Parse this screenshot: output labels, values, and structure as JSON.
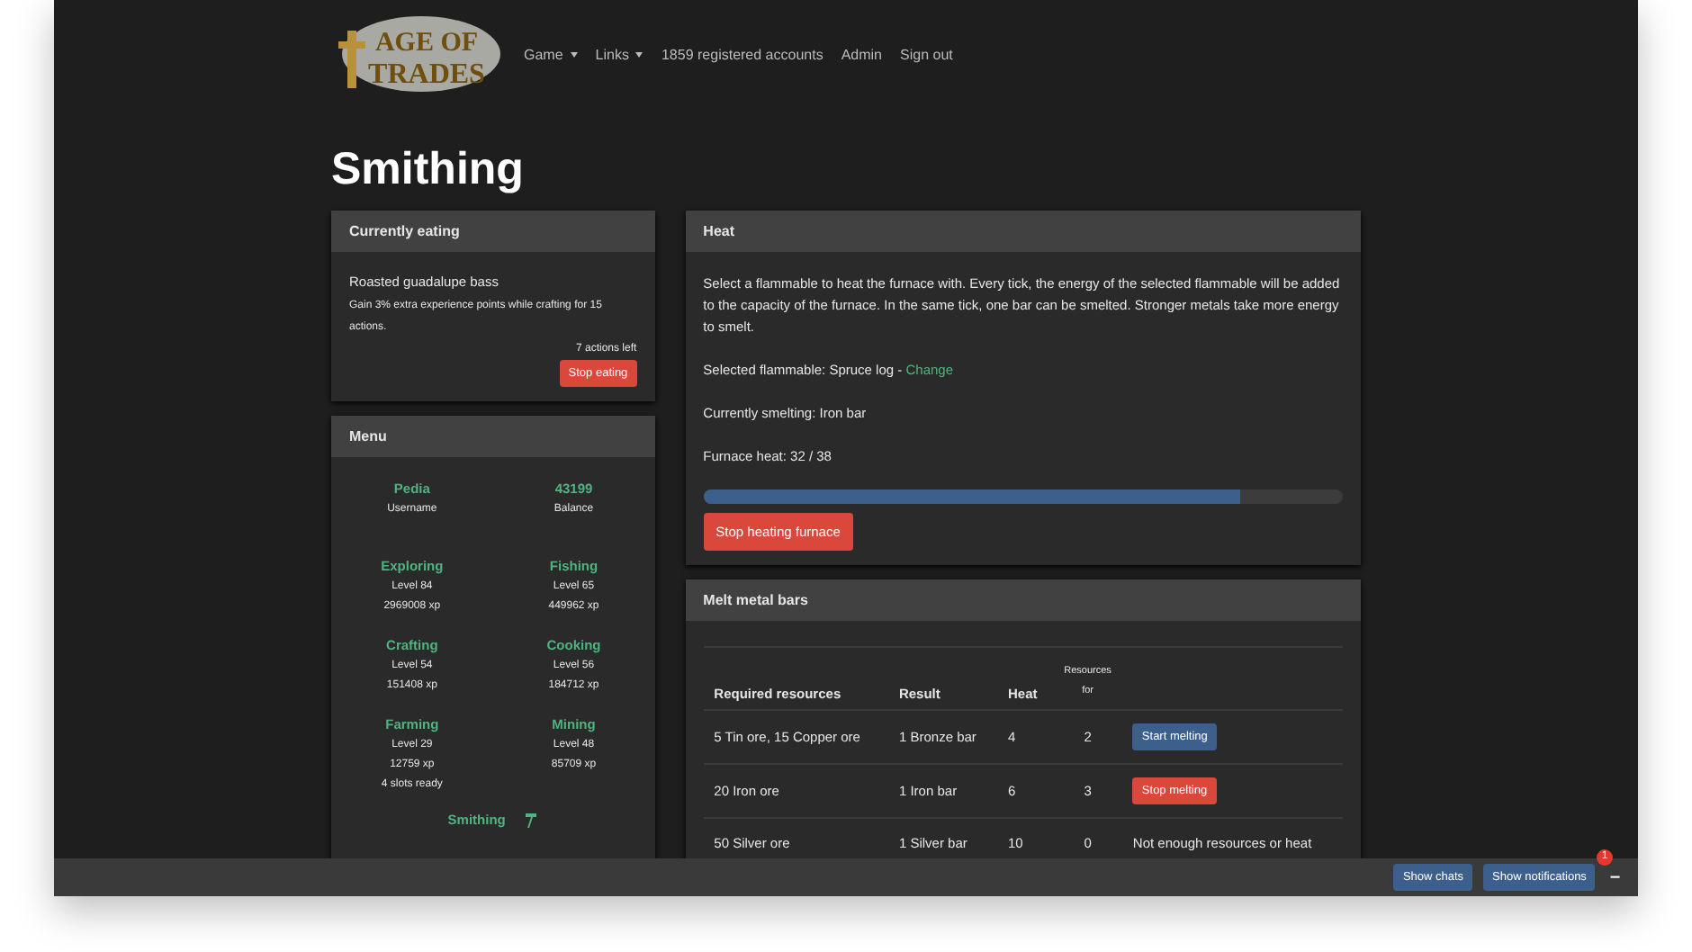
{
  "logo": {
    "lines": [
      "AGE OF",
      "TRADES"
    ]
  },
  "nav": [
    {
      "label": "Game",
      "dropdown": true
    },
    {
      "label": "Links",
      "dropdown": true
    },
    {
      "label": "1859 registered accounts",
      "dropdown": false
    },
    {
      "label": "Admin",
      "dropdown": false
    },
    {
      "label": "Sign out",
      "dropdown": false
    }
  ],
  "page_title": "Smithing",
  "eating": {
    "title": "Currently eating",
    "food": "Roasted guadalupe bass",
    "effect": "Gain 3% extra experience points while crafting for 15 actions.",
    "remaining": "7 actions left",
    "button": "Stop eating"
  },
  "menu": {
    "title": "Menu",
    "items": [
      {
        "title": "Pedia",
        "lines": [
          "Username"
        ]
      },
      {
        "title": "43199",
        "lines": [
          "Balance"
        ]
      },
      {
        "title": "Exploring",
        "lines": [
          "Level 84",
          "2969008 xp"
        ]
      },
      {
        "title": "Fishing",
        "lines": [
          "Level 65",
          "449962 xp"
        ]
      },
      {
        "title": "Crafting",
        "lines": [
          "Level 54",
          "151408 xp"
        ]
      },
      {
        "title": "Cooking",
        "lines": [
          "Level 56",
          "184712 xp"
        ]
      },
      {
        "title": "Farming",
        "lines": [
          "Level 29",
          "12759 xp",
          "4 slots ready"
        ]
      },
      {
        "title": "Mining",
        "lines": [
          "Level 48",
          "85709 xp"
        ]
      }
    ],
    "current": {
      "title": "Smithing"
    }
  },
  "heat": {
    "title": "Heat",
    "description": "Select a flammable to heat the furnace with. Every tick, the energy of the selected flammable will be added to the capacity of the furnace. In the same tick, one bar can be smelted. Stronger metals take more energy to smelt.",
    "flammable_label": "Selected flammable: Spruce log - ",
    "change_link": "Change",
    "smelting": "Currently smelting: Iron bar",
    "furnace_heat": "Furnace heat: 32 / 38",
    "level": 0.84,
    "button": "Stop heating furnace"
  },
  "melt": {
    "title": "Melt metal bars",
    "columns": [
      "Required resources",
      "Result",
      "Heat",
      "Resources for"
    ],
    "rows": [
      {
        "resources": "5 Tin ore, 15 Copper ore",
        "result": "1 Bronze bar",
        "heat": "4",
        "count": "2",
        "action": {
          "kind": "start",
          "label": "Start melting"
        }
      },
      {
        "resources": "20 Iron ore",
        "result": "1 Iron bar",
        "heat": "6",
        "count": "3",
        "action": {
          "kind": "stop",
          "label": "Stop melting"
        }
      },
      {
        "resources": "50 Silver ore",
        "result": "1 Silver bar",
        "heat": "10",
        "count": "0",
        "action": {
          "kind": "text",
          "label": "Not enough resources or heat"
        }
      }
    ]
  },
  "footer": {
    "buttons": [
      "Show chats",
      "Show notifications"
    ],
    "badge": "1",
    "minimize": "–"
  }
}
